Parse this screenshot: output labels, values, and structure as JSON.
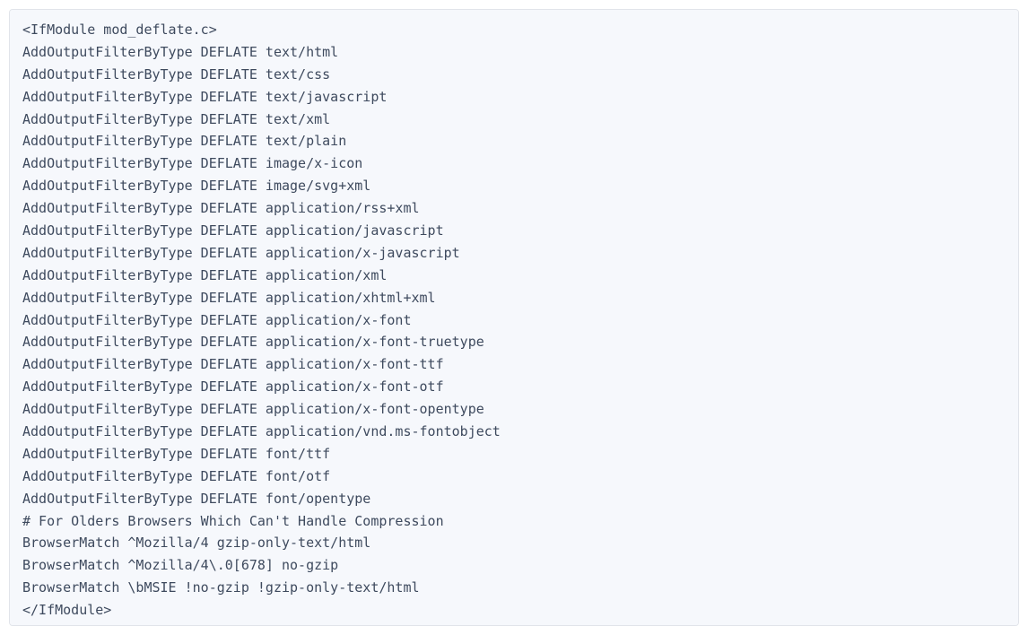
{
  "code": {
    "lines": [
      "<IfModule mod_deflate.c>",
      "AddOutputFilterByType DEFLATE text/html",
      "AddOutputFilterByType DEFLATE text/css",
      "AddOutputFilterByType DEFLATE text/javascript",
      "AddOutputFilterByType DEFLATE text/xml",
      "AddOutputFilterByType DEFLATE text/plain",
      "AddOutputFilterByType DEFLATE image/x-icon",
      "AddOutputFilterByType DEFLATE image/svg+xml",
      "AddOutputFilterByType DEFLATE application/rss+xml",
      "AddOutputFilterByType DEFLATE application/javascript",
      "AddOutputFilterByType DEFLATE application/x-javascript",
      "AddOutputFilterByType DEFLATE application/xml",
      "AddOutputFilterByType DEFLATE application/xhtml+xml",
      "AddOutputFilterByType DEFLATE application/x-font",
      "AddOutputFilterByType DEFLATE application/x-font-truetype",
      "AddOutputFilterByType DEFLATE application/x-font-ttf",
      "AddOutputFilterByType DEFLATE application/x-font-otf",
      "AddOutputFilterByType DEFLATE application/x-font-opentype",
      "AddOutputFilterByType DEFLATE application/vnd.ms-fontobject",
      "AddOutputFilterByType DEFLATE font/ttf",
      "AddOutputFilterByType DEFLATE font/otf",
      "AddOutputFilterByType DEFLATE font/opentype",
      "# For Olders Browsers Which Can't Handle Compression",
      "BrowserMatch ^Mozilla/4 gzip-only-text/html",
      "BrowserMatch ^Mozilla/4\\.0[678] no-gzip",
      "BrowserMatch \\bMSIE !no-gzip !gzip-only-text/html",
      "</IfModule>"
    ]
  }
}
